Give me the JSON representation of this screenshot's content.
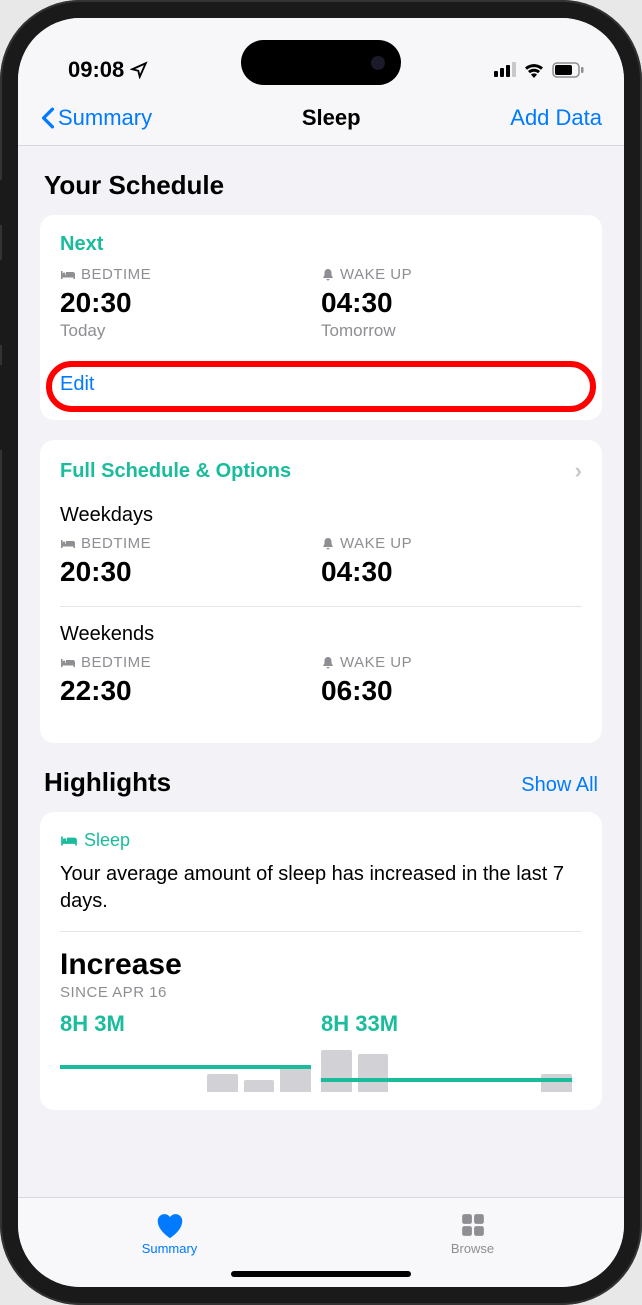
{
  "status": {
    "time": "09:08"
  },
  "nav": {
    "back": "Summary",
    "title": "Sleep",
    "add": "Add Data"
  },
  "schedule_title": "Your Schedule",
  "next": {
    "label": "Next",
    "bedtime_label": "BEDTIME",
    "bedtime": "20:30",
    "bedtime_day": "Today",
    "wakeup_label": "WAKE UP",
    "wakeup": "04:30",
    "wakeup_day": "Tomorrow",
    "edit": "Edit"
  },
  "full": {
    "title": "Full Schedule & Options",
    "weekdays": {
      "label": "Weekdays",
      "bedtime_label": "BEDTIME",
      "bedtime": "20:30",
      "wakeup_label": "WAKE UP",
      "wakeup": "04:30"
    },
    "weekends": {
      "label": "Weekends",
      "bedtime_label": "BEDTIME",
      "bedtime": "22:30",
      "wakeup_label": "WAKE UP",
      "wakeup": "06:30"
    }
  },
  "highlights": {
    "title": "Highlights",
    "show_all": "Show All",
    "sleep_tag": "Sleep",
    "summary": "Your average amount of sleep has increased in the last 7 days.",
    "increase": "Increase",
    "since": "SINCE APR 16",
    "before": "8H 3M",
    "after": "8H 33M"
  },
  "tabs": {
    "summary": "Summary",
    "browse": "Browse"
  },
  "chart_data": {
    "type": "bar",
    "series": [
      {
        "name": "before",
        "label": "8H 3M",
        "values": [
          0,
          0,
          0,
          0,
          18,
          12,
          25
        ]
      },
      {
        "name": "after",
        "label": "8H 33M",
        "values": [
          42,
          38,
          0,
          0,
          0,
          0,
          18
        ]
      }
    ],
    "lines": {
      "before_y": 23,
      "after_y": 10
    }
  }
}
